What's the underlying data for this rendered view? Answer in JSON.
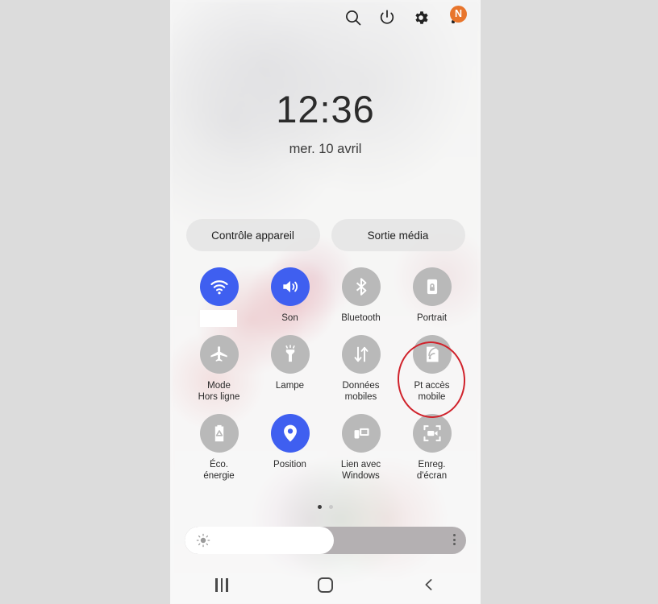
{
  "header": {
    "icons": [
      {
        "name": "search-icon",
        "label": "Rechercher"
      },
      {
        "name": "power-icon",
        "label": "Alimentation"
      },
      {
        "name": "gear-icon",
        "label": "Paramètres"
      },
      {
        "name": "more-options-icon",
        "label": "Plus d'options"
      }
    ],
    "badge_letter": "N"
  },
  "clock": {
    "time": "12:36",
    "date": "mer. 10 avril"
  },
  "pills": [
    {
      "label": "Contrôle appareil",
      "name": "device-control-button"
    },
    {
      "label": "Sortie média",
      "name": "media-output-button"
    }
  ],
  "toggles": {
    "rows": [
      [
        {
          "label": "",
          "icon": "wifi-icon",
          "state": "on",
          "name": "toggle-wifi",
          "redacted": true
        },
        {
          "label": "Son",
          "icon": "sound-icon",
          "state": "on",
          "name": "toggle-sound"
        },
        {
          "label": "Bluetooth",
          "icon": "bluetooth-icon",
          "state": "off",
          "name": "toggle-bluetooth"
        },
        {
          "label": "Portrait",
          "icon": "rotation-lock-icon",
          "state": "off",
          "name": "toggle-portrait"
        }
      ],
      [
        {
          "label": "Mode\nHors ligne",
          "icon": "airplane-icon",
          "state": "off",
          "name": "toggle-airplane-mode"
        },
        {
          "label": "Lampe",
          "icon": "flashlight-icon",
          "state": "off",
          "name": "toggle-flashlight"
        },
        {
          "label": "Données\nmobiles",
          "icon": "mobile-data-icon",
          "state": "off",
          "name": "toggle-mobile-data"
        },
        {
          "label": "Pt accès\nmobile",
          "icon": "hotspot-icon",
          "state": "off",
          "name": "toggle-mobile-hotspot",
          "highlighted": true
        }
      ],
      [
        {
          "label": "Éco.\nénergie",
          "icon": "battery-saver-icon",
          "state": "off",
          "name": "toggle-power-saving"
        },
        {
          "label": "Position",
          "icon": "location-pin-icon",
          "state": "on",
          "name": "toggle-location"
        },
        {
          "label": "Lien avec\nWindows",
          "icon": "link-to-windows-icon",
          "state": "off",
          "name": "toggle-link-to-windows"
        },
        {
          "label": "Enreg.\nd'écran",
          "icon": "screen-record-icon",
          "state": "off",
          "name": "toggle-screen-recorder"
        }
      ]
    ]
  },
  "pagination": {
    "pages": 2,
    "active": 1
  },
  "brightness": {
    "percent": 53,
    "icon": "brightness-sun-icon",
    "menu_icon": "more-options-icon"
  },
  "navbar": [
    {
      "name": "nav-recents-button",
      "icon": "recents-icon"
    },
    {
      "name": "nav-home-button",
      "icon": "home-icon"
    },
    {
      "name": "nav-back-button",
      "icon": "back-chevron-icon"
    }
  ],
  "annotation": {
    "target": "toggle-mobile-hotspot",
    "color": "#d0222b",
    "shape": "ellipse"
  },
  "colors": {
    "accent_on": "#3f5ff0",
    "toggle_off": "#b9b9b9",
    "badge": "#e8752c",
    "page_bg": "#dcdcdc"
  }
}
